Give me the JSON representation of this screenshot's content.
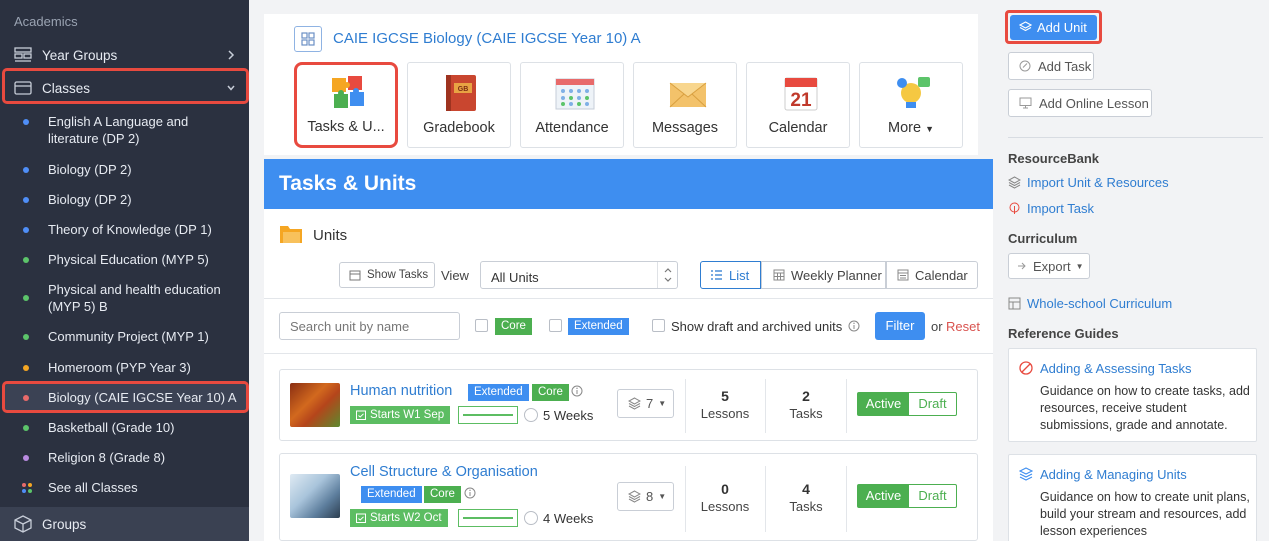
{
  "sidebar": {
    "section_label": "Academics",
    "year_groups": "Year Groups",
    "classes": "Classes",
    "items": [
      {
        "label": "English A Language and literature (DP 2)",
        "dot_color": "#4f8ef7"
      },
      {
        "label": "Biology (DP 2)",
        "dot_color": "#4f8ef7"
      },
      {
        "label": "Biology (DP 2)",
        "dot_color": "#4f8ef7"
      },
      {
        "label": "Theory of Knowledge (DP 1)",
        "dot_color": "#4f8ef7"
      },
      {
        "label": "Physical Education (MYP 5)",
        "dot_color": "#5cc46a"
      },
      {
        "label": "Physical and health education (MYP 5) B",
        "dot_color": "#5cc46a"
      },
      {
        "label": "Community Project (MYP 1)",
        "dot_color": "#5cc46a"
      },
      {
        "label": "Homeroom (PYP Year 3)",
        "dot_color": "#f5a623"
      },
      {
        "label": "Biology (CAIE IGCSE Year 10) A",
        "dot_color": "#e86a6a"
      },
      {
        "label": "Basketball (Grade 10)",
        "dot_color": "#5cc46a"
      },
      {
        "label": "Religion 8 (Grade 8)",
        "dot_color": "#b98be0"
      },
      {
        "label": "See all Classes",
        "dot_color": "multi"
      }
    ],
    "groups": "Groups"
  },
  "course": {
    "title": "CAIE IGCSE Biology (CAIE IGCSE Year 10) A",
    "tiles": [
      {
        "label": "Tasks & U...",
        "icon": "puzzle-icon"
      },
      {
        "label": "Gradebook",
        "icon": "gradebook-icon"
      },
      {
        "label": "Attendance",
        "icon": "attendance-icon"
      },
      {
        "label": "Messages",
        "icon": "envelope-icon"
      },
      {
        "label": "Calendar",
        "icon": "calendar-icon"
      },
      {
        "label": "More",
        "icon": "lightbulb-icon"
      }
    ],
    "calendar_day": "21",
    "gradebook_mark": "GB"
  },
  "tasks": {
    "header": "Tasks & Units",
    "units_label": "Units",
    "show_tasks": "Show Tasks",
    "view_label": "View",
    "units_select": "All Units",
    "view_list": "List",
    "view_weekly": "Weekly Planner",
    "view_calendar": "Calendar",
    "search_placeholder": "Search unit by name",
    "core": "Core",
    "extended": "Extended",
    "show_draft": "Show draft and archived units",
    "filter": "Filter",
    "or": "or",
    "reset": "Reset",
    "units": [
      {
        "name": "Human nutrition",
        "tag1": "Extended",
        "tag2": "Core",
        "start": "Starts W1 Sep",
        "weeks": "5 Weeks",
        "stack": "7",
        "lessons": "5",
        "lessons_label": "Lessons",
        "tasks": "2",
        "tasks_label": "Tasks",
        "active": "Active",
        "draft": "Draft"
      },
      {
        "name": "Cell Structure & Organisation",
        "tag1": "Extended",
        "tag2": "Core",
        "start": "Starts W2 Oct",
        "weeks": "4 Weeks",
        "stack": "8",
        "lessons": "0",
        "lessons_label": "Lessons",
        "tasks": "4",
        "tasks_label": "Tasks",
        "active": "Active",
        "draft": "Draft"
      }
    ]
  },
  "right": {
    "add_unit": "Add Unit",
    "add_task": "Add Task",
    "add_online_lesson": "Add Online Lesson",
    "resource_bank": "ResourceBank",
    "import_unit": "Import Unit & Resources",
    "import_task": "Import Task",
    "curriculum": "Curriculum",
    "export": "Export",
    "whole_school": "Whole-school Curriculum",
    "reference_guides": "Reference Guides",
    "guides": [
      {
        "title": "Adding & Assessing Tasks",
        "desc": "Guidance on how to create tasks, add resources, receive student submissions, grade and annotate."
      },
      {
        "title": "Adding & Managing Units",
        "desc": "Guidance on how to create unit plans, build your stream and resources, add lesson experiences"
      }
    ]
  },
  "colors": {
    "accent": "#3e8ef0",
    "highlight": "#e84a3f",
    "active_green": "#4caf50",
    "sidebar": "#2b3140"
  }
}
